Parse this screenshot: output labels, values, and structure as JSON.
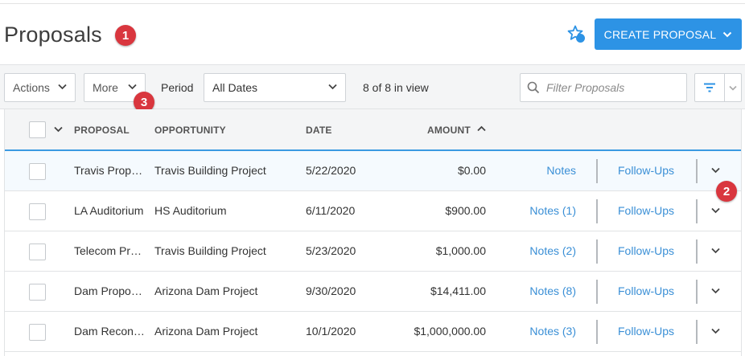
{
  "header": {
    "title": "Proposals",
    "create_button_label": "CREATE PROPOSAL",
    "favorite_icon": "star-add-icon"
  },
  "annotations": {
    "badge_1": "1",
    "badge_2": "2",
    "badge_3": "3",
    "badge_color": "#d9363e"
  },
  "toolbar": {
    "actions_label": "Actions",
    "more_label": "More",
    "period_label": "Period",
    "period_value": "All Dates",
    "view_count": "8 of 8 in view",
    "filter_placeholder": "Filter Proposals"
  },
  "table": {
    "columns": {
      "proposal": "PROPOSAL",
      "opportunity": "OPPORTUNITY",
      "date": "DATE",
      "amount": "AMOUNT"
    },
    "sort": {
      "column": "amount",
      "direction": "ascending"
    },
    "rows": [
      {
        "proposal": "Travis Proposal",
        "opportunity": "Travis Building Project",
        "date": "5/22/2020",
        "amount": "$0.00",
        "notes": "Notes",
        "followups": "Follow-Ups",
        "highlighted": true
      },
      {
        "proposal": "LA Auditorium",
        "opportunity": "HS Auditorium",
        "date": "6/11/2020",
        "amount": "$900.00",
        "notes": "Notes (1)",
        "followups": "Follow-Ups",
        "highlighted": false
      },
      {
        "proposal": "Telecom Proposal",
        "opportunity": "Travis Building Project",
        "date": "5/23/2020",
        "amount": "$1,000.00",
        "notes": "Notes (2)",
        "followups": "Follow-Ups",
        "highlighted": false
      },
      {
        "proposal": "Dam Proposal",
        "opportunity": "Arizona Dam Project",
        "date": "9/30/2020",
        "amount": "$14,411.00",
        "notes": "Notes (8)",
        "followups": "Follow-Ups",
        "highlighted": false
      },
      {
        "proposal": "Dam Reconstruction",
        "opportunity": "Arizona Dam Project",
        "date": "10/1/2020",
        "amount": "$1,000,000.00",
        "notes": "Notes (3)",
        "followups": "Follow-Ups",
        "highlighted": false
      }
    ]
  },
  "colors": {
    "accent": "#2d93e5",
    "link": "#3a8fd6",
    "header_underline": "#3b9ae1"
  }
}
